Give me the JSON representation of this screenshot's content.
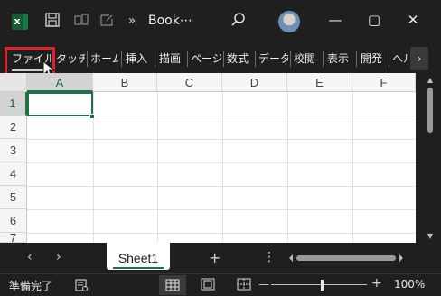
{
  "titlebar": {
    "app_icon": "excel-icon",
    "more_label": "»",
    "title": "Book⋯",
    "search_icon": "search-icon",
    "minimize": "—",
    "maximize": "▢",
    "close": "✕"
  },
  "ribbon": {
    "tabs": [
      {
        "label": "ファイル"
      },
      {
        "label": "タッチ"
      },
      {
        "label": "ホーム"
      },
      {
        "label": "挿入"
      },
      {
        "label": "描画"
      },
      {
        "label": "ページ"
      },
      {
        "label": "数式"
      },
      {
        "label": "データ"
      },
      {
        "label": "校閲"
      },
      {
        "label": "表示"
      },
      {
        "label": "開発"
      },
      {
        "label": "ヘルプ"
      }
    ],
    "more_label": "›",
    "highlight_color": "#e0202a"
  },
  "grid": {
    "columns": [
      "A",
      "B",
      "C",
      "D",
      "E",
      "F"
    ],
    "rows": [
      "1",
      "2",
      "3",
      "4",
      "5",
      "6",
      "7"
    ],
    "selected_cell": "A1",
    "accent": "#1e7145"
  },
  "sheetbar": {
    "prev_label": "‹",
    "next_label": "›",
    "active_sheet": "Sheet1",
    "add_label": "+",
    "menu_label": "⋮"
  },
  "statusbar": {
    "status": "準備完了",
    "zoom": "100%",
    "zoom_minus": "—",
    "zoom_plus": "+"
  }
}
